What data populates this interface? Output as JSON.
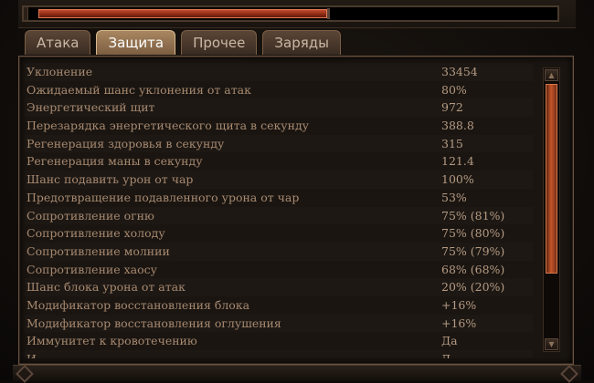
{
  "progress": {
    "fill_fraction": 0.56
  },
  "tabs": [
    {
      "label": "Атака",
      "active": false
    },
    {
      "label": "Защита",
      "active": true
    },
    {
      "label": "Прочее",
      "active": false
    },
    {
      "label": "Заряды",
      "active": false
    }
  ],
  "stats": [
    {
      "name": "Уклонение",
      "value": "33454"
    },
    {
      "name": "Ожидаемый шанс уклонения от атак",
      "value": "80%"
    },
    {
      "name": "Энергетический щит",
      "value": "972"
    },
    {
      "name": "Перезарядка энергетического щита в секунду",
      "value": "388.8"
    },
    {
      "name": "Регенерация здоровья в секунду",
      "value": "315"
    },
    {
      "name": "Регенерация маны в секунду",
      "value": "121.4"
    },
    {
      "name": "Шанс подавить урон от чар",
      "value": "100%"
    },
    {
      "name": "Предотвращение подавленного урона от чар",
      "value": "53%"
    },
    {
      "name": "Сопротивление огню",
      "value": "75% (81%)"
    },
    {
      "name": "Сопротивление холоду",
      "value": "75% (80%)"
    },
    {
      "name": "Сопротивление молнии",
      "value": "75% (79%)"
    },
    {
      "name": "Сопротивление хаосу",
      "value": "68% (68%)"
    },
    {
      "name": "Шанс блока урона от атак",
      "value": "20% (20%)"
    },
    {
      "name": "Модификатор восстановления блока",
      "value": "+16%"
    },
    {
      "name": "Модификатор восстановления оглушения",
      "value": "+16%"
    },
    {
      "name": "Иммунитет к кровотечению",
      "value": "Да"
    },
    {
      "name": "И",
      "value": "Д"
    }
  ],
  "scrollbar": {
    "up_glyph": "▲",
    "down_glyph": "▼"
  },
  "colors": {
    "accent_fill": "#b0452a",
    "text": "#a88a70",
    "active_tab": "#a98661"
  }
}
